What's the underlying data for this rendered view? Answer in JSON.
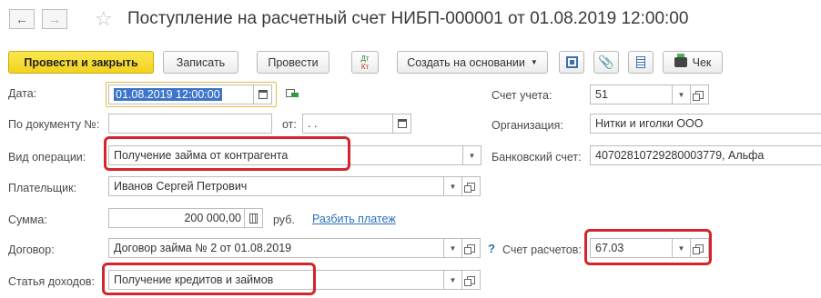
{
  "header": {
    "title": "Поступление на расчетный счет НИБП-000001 от 01.08.2019 12:00:00",
    "back_icon": "arrow-left-icon",
    "forward_icon": "arrow-right-icon",
    "favorite_icon": "star-icon"
  },
  "toolbar": {
    "post_close_label": "Провести и закрыть",
    "save_label": "Записать",
    "post_label": "Провести",
    "dt_kt_top": "Дт",
    "dt_kt_bottom": "Кт",
    "create_based_label": "Создать на основании",
    "receipt_label": "Чек"
  },
  "form": {
    "date_label": "Дата:",
    "date_value": "01.08.2019 12:00:00",
    "doc_num_label": "По документу №:",
    "doc_num_value": "",
    "from_label": "от:",
    "from_value": " .  .",
    "operation_label": "Вид операции:",
    "operation_value": "Получение займа от контрагента",
    "payer_label": "Плательщик:",
    "payer_value": "Иванов Сергей Петрович",
    "amount_label": "Сумма:",
    "amount_value": "200 000,00",
    "currency": "руб.",
    "split_link": "Разбить платеж",
    "contract_label": "Договор:",
    "contract_value": "Договор займа № 2 от 01.08.2019",
    "income_item_label": "Статья доходов:",
    "income_item_value": "Получение кредитов и займов",
    "account_label": "Счет учета:",
    "account_value": "51",
    "org_label": "Организация:",
    "org_value": "Нитки и иголки ООО",
    "bank_account_label": "Банковский счет:",
    "bank_account_value": "40702810729280003779, Альфа",
    "settlement_label": "Счет расчетов:",
    "settlement_value": "67.03",
    "help_mark": "?"
  },
  "colors": {
    "accent_yellow": "#f2d21e",
    "highlight_red": "#d4262a",
    "link_blue": "#2a6fb8"
  }
}
